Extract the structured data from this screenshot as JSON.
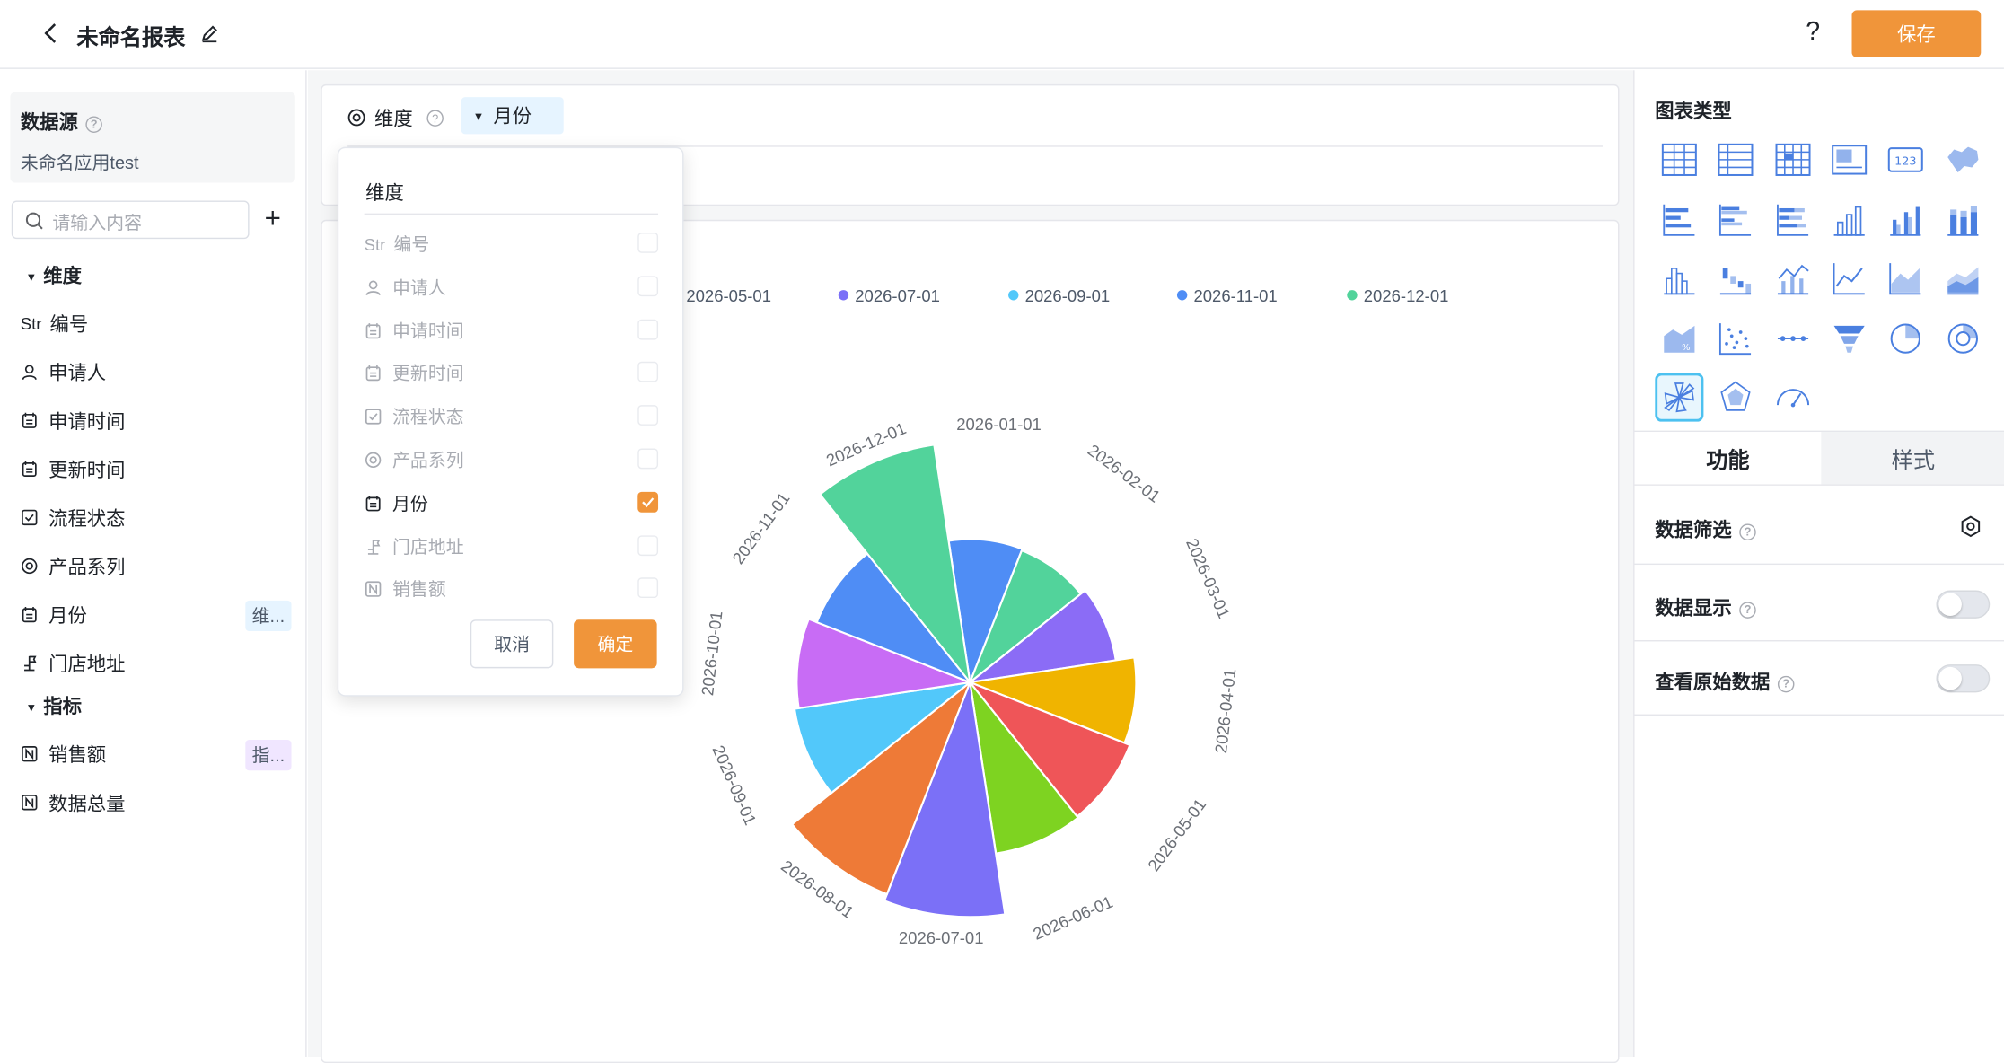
{
  "header": {
    "title": "未命名报表",
    "help": "?",
    "save_label": "保存"
  },
  "sidebar": {
    "datasource_label": "数据源",
    "datasource_name": "未命名应用test",
    "search_placeholder": "请输入内容",
    "add": "+",
    "dimensions_label": "维度",
    "metrics_label": "指标",
    "dimension_fields": [
      {
        "icon": "Str",
        "label": "编号"
      },
      {
        "icon": "user-icon",
        "label": "申请人"
      },
      {
        "icon": "calendar-icon",
        "label": "申请时间"
      },
      {
        "icon": "calendar-icon",
        "label": "更新时间"
      },
      {
        "icon": "checkbox-icon",
        "label": "流程状态"
      },
      {
        "icon": "radio-icon",
        "label": "产品系列"
      },
      {
        "icon": "calendar-icon",
        "label": "月份",
        "tag": "维..."
      },
      {
        "icon": "location-icon",
        "label": "门店地址"
      }
    ],
    "metric_fields": [
      {
        "icon": "number-icon",
        "label": "销售额",
        "tag": "指..."
      },
      {
        "icon": "number-icon",
        "label": "数据总量"
      }
    ]
  },
  "toolbar": {
    "dimension_label": "维度",
    "selected_dimension": "月份"
  },
  "dropdown": {
    "title": "维度",
    "options": [
      {
        "icon": "Str",
        "label": "编号",
        "checked": false
      },
      {
        "icon": "user-icon",
        "label": "申请人",
        "checked": false
      },
      {
        "icon": "calendar-icon",
        "label": "申请时间",
        "checked": false
      },
      {
        "icon": "calendar-icon",
        "label": "更新时间",
        "checked": false
      },
      {
        "icon": "checkbox-icon",
        "label": "流程状态",
        "checked": false
      },
      {
        "icon": "radio-icon",
        "label": "产品系列",
        "checked": false
      },
      {
        "icon": "calendar-icon",
        "label": "月份",
        "checked": true
      },
      {
        "icon": "location-icon",
        "label": "门店地址",
        "checked": false
      },
      {
        "icon": "number-icon",
        "label": "销售额",
        "checked": false
      }
    ],
    "cancel": "取消",
    "confirm": "确定"
  },
  "right_panel": {
    "chart_type_label": "图表类型",
    "tabs": [
      "功能",
      "样式"
    ],
    "data_filter": "数据筛选",
    "data_display": "数据显示",
    "raw_data": "查看原始数据"
  },
  "chart_data": {
    "type": "pie",
    "subtype": "rose",
    "categories": [
      "2026-01-01",
      "2026-02-01",
      "2026-03-01",
      "2026-04-01",
      "2026-05-01",
      "2026-06-01",
      "2026-07-01",
      "2026-08-01",
      "2026-09-01",
      "2026-10-01",
      "2026-11-01",
      "2026-12-01"
    ],
    "values": [
      1.0,
      0.99,
      1.03,
      1.16,
      1.2,
      1.21,
      1.64,
      1.59,
      1.24,
      1.21,
      1.15,
      1.68
    ],
    "colors": [
      "#4f8df5",
      "#52d39b",
      "#8b6cf6",
      "#f0b400",
      "#ef5558",
      "#7ed321",
      "#7b70f7",
      "#ee7a37",
      "#52c8fa",
      "#c86cf5",
      "#4f8df5",
      "#52d39b"
    ],
    "legend_visible": [
      "2026-05-01",
      "2026-07-01",
      "2026-09-01",
      "2026-11-01",
      "2026-12-01"
    ],
    "legend_colors": [
      "#ef5558",
      "#7b70f7",
      "#52c8fa",
      "#4f8df5",
      "#52d39b"
    ],
    "legend_position": "top"
  }
}
